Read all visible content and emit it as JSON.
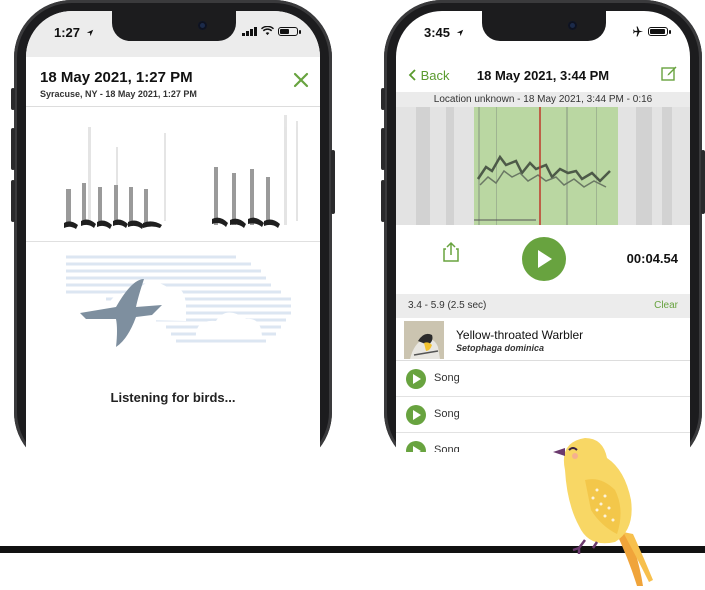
{
  "left_phone": {
    "status_time": "1:27",
    "header_title": "18 May 2021, 1:27 PM",
    "header_subtitle": "Syracuse, NY - 18 May 2021, 1:27 PM",
    "listening_text": "Listening for birds..."
  },
  "right_phone": {
    "status_time": "3:45",
    "back_label": "Back",
    "nav_title": "18 May 2021, 3:44 PM",
    "location_bar": "Location unknown - 18 May 2021, 3:44 PM - 0:16",
    "elapsed_time": "00:04.54",
    "selection_range": "3.4 - 5.9 (2.5 sec)",
    "clear_label": "Clear",
    "species": {
      "common_name": "Yellow-throated Warbler",
      "scientific_name": "Setophaga dominica"
    },
    "songs": [
      {
        "label": "Song"
      },
      {
        "label": "Song"
      },
      {
        "label": "Song"
      }
    ]
  },
  "colors": {
    "accent_green": "#68a33f",
    "selection_green": "#b5d59a",
    "marker_red": "#c0392b"
  },
  "icons": [
    "location-arrow-icon",
    "signal-icon",
    "wifi-icon",
    "battery-icon",
    "close-icon",
    "airplane-icon",
    "chevron-left-icon",
    "edit-icon",
    "share-icon",
    "play-icon"
  ]
}
